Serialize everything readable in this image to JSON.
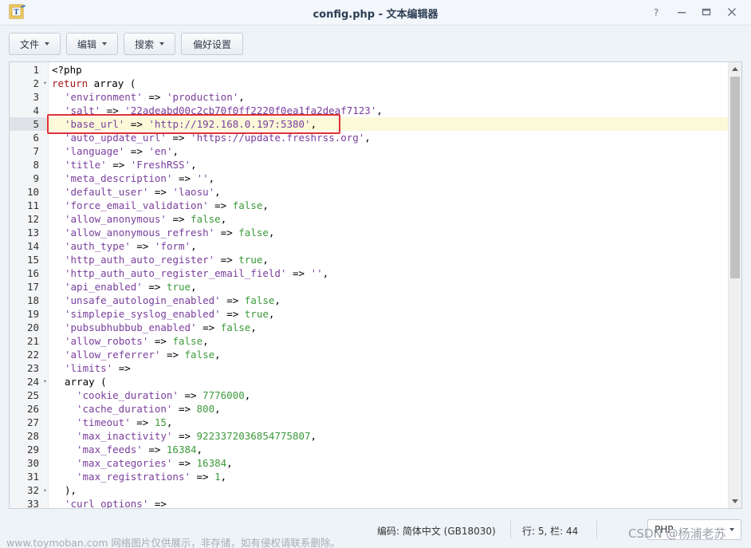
{
  "window": {
    "title": "config.php - 文本编辑器",
    "app_icon": "text-editor-icon",
    "controls": [
      "help-icon",
      "minimize-icon",
      "maximize-icon",
      "close-icon"
    ]
  },
  "toolbar": {
    "file_label": "文件",
    "edit_label": "编辑",
    "search_label": "搜索",
    "prefs_label": "偏好设置"
  },
  "editor": {
    "active_line": 5,
    "lines": [
      {
        "n": "1",
        "fold": "",
        "tokens": [
          {
            "t": "<?php",
            "c": "plain"
          }
        ]
      },
      {
        "n": "2",
        "fold": "▾",
        "tokens": [
          {
            "t": "return",
            "c": "kw"
          },
          {
            "t": " array (",
            "c": "plain"
          }
        ]
      },
      {
        "n": "3",
        "fold": "",
        "indent": 1,
        "tokens": [
          {
            "t": "'environment'",
            "c": "str"
          },
          {
            "t": " => ",
            "c": "op"
          },
          {
            "t": "'production'",
            "c": "str"
          },
          {
            "t": ",",
            "c": "op"
          }
        ]
      },
      {
        "n": "4",
        "fold": "",
        "indent": 1,
        "tokens": [
          {
            "t": "'salt'",
            "c": "str"
          },
          {
            "t": " => ",
            "c": "op"
          },
          {
            "t": "'22adeabd00c2cb70f0ff2220f0ea1fa2deaf7123'",
            "c": "str"
          },
          {
            "t": ",",
            "c": "op"
          }
        ]
      },
      {
        "n": "5",
        "fold": "",
        "indent": 1,
        "tokens": [
          {
            "t": "'base_url'",
            "c": "str"
          },
          {
            "t": " => ",
            "c": "op"
          },
          {
            "t": "'http://192.168.0.197:5380'",
            "c": "str"
          },
          {
            "t": ",",
            "c": "op"
          }
        ]
      },
      {
        "n": "6",
        "fold": "",
        "indent": 1,
        "tokens": [
          {
            "t": "'auto_update_url'",
            "c": "str"
          },
          {
            "t": " => ",
            "c": "op"
          },
          {
            "t": "'https://update.freshrss.org'",
            "c": "str"
          },
          {
            "t": ",",
            "c": "op"
          }
        ]
      },
      {
        "n": "7",
        "fold": "",
        "indent": 1,
        "tokens": [
          {
            "t": "'language'",
            "c": "str"
          },
          {
            "t": " => ",
            "c": "op"
          },
          {
            "t": "'en'",
            "c": "str"
          },
          {
            "t": ",",
            "c": "op"
          }
        ]
      },
      {
        "n": "8",
        "fold": "",
        "indent": 1,
        "tokens": [
          {
            "t": "'title'",
            "c": "str"
          },
          {
            "t": " => ",
            "c": "op"
          },
          {
            "t": "'FreshRSS'",
            "c": "str"
          },
          {
            "t": ",",
            "c": "op"
          }
        ]
      },
      {
        "n": "9",
        "fold": "",
        "indent": 1,
        "tokens": [
          {
            "t": "'meta_description'",
            "c": "str"
          },
          {
            "t": " => ",
            "c": "op"
          },
          {
            "t": "''",
            "c": "str"
          },
          {
            "t": ",",
            "c": "op"
          }
        ]
      },
      {
        "n": "10",
        "fold": "",
        "indent": 1,
        "tokens": [
          {
            "t": "'default_user'",
            "c": "str"
          },
          {
            "t": " => ",
            "c": "op"
          },
          {
            "t": "'laosu'",
            "c": "str"
          },
          {
            "t": ",",
            "c": "op"
          }
        ]
      },
      {
        "n": "11",
        "fold": "",
        "indent": 1,
        "tokens": [
          {
            "t": "'force_email_validation'",
            "c": "str"
          },
          {
            "t": " => ",
            "c": "op"
          },
          {
            "t": "false",
            "c": "bool"
          },
          {
            "t": ",",
            "c": "op"
          }
        ]
      },
      {
        "n": "12",
        "fold": "",
        "indent": 1,
        "tokens": [
          {
            "t": "'allow_anonymous'",
            "c": "str"
          },
          {
            "t": " => ",
            "c": "op"
          },
          {
            "t": "false",
            "c": "bool"
          },
          {
            "t": ",",
            "c": "op"
          }
        ]
      },
      {
        "n": "13",
        "fold": "",
        "indent": 1,
        "tokens": [
          {
            "t": "'allow_anonymous_refresh'",
            "c": "str"
          },
          {
            "t": " => ",
            "c": "op"
          },
          {
            "t": "false",
            "c": "bool"
          },
          {
            "t": ",",
            "c": "op"
          }
        ]
      },
      {
        "n": "14",
        "fold": "",
        "indent": 1,
        "tokens": [
          {
            "t": "'auth_type'",
            "c": "str"
          },
          {
            "t": " => ",
            "c": "op"
          },
          {
            "t": "'form'",
            "c": "str"
          },
          {
            "t": ",",
            "c": "op"
          }
        ]
      },
      {
        "n": "15",
        "fold": "",
        "indent": 1,
        "tokens": [
          {
            "t": "'http_auth_auto_register'",
            "c": "str"
          },
          {
            "t": " => ",
            "c": "op"
          },
          {
            "t": "true",
            "c": "bool"
          },
          {
            "t": ",",
            "c": "op"
          }
        ]
      },
      {
        "n": "16",
        "fold": "",
        "indent": 1,
        "tokens": [
          {
            "t": "'http_auth_auto_register_email_field'",
            "c": "str"
          },
          {
            "t": " => ",
            "c": "op"
          },
          {
            "t": "''",
            "c": "str"
          },
          {
            "t": ",",
            "c": "op"
          }
        ]
      },
      {
        "n": "17",
        "fold": "",
        "indent": 1,
        "tokens": [
          {
            "t": "'api_enabled'",
            "c": "str"
          },
          {
            "t": " => ",
            "c": "op"
          },
          {
            "t": "true",
            "c": "bool"
          },
          {
            "t": ",",
            "c": "op"
          }
        ]
      },
      {
        "n": "18",
        "fold": "",
        "indent": 1,
        "tokens": [
          {
            "t": "'unsafe_autologin_enabled'",
            "c": "str"
          },
          {
            "t": " => ",
            "c": "op"
          },
          {
            "t": "false",
            "c": "bool"
          },
          {
            "t": ",",
            "c": "op"
          }
        ]
      },
      {
        "n": "19",
        "fold": "",
        "indent": 1,
        "tokens": [
          {
            "t": "'simplepie_syslog_enabled'",
            "c": "str"
          },
          {
            "t": " => ",
            "c": "op"
          },
          {
            "t": "true",
            "c": "bool"
          },
          {
            "t": ",",
            "c": "op"
          }
        ]
      },
      {
        "n": "20",
        "fold": "",
        "indent": 1,
        "tokens": [
          {
            "t": "'pubsubhubbub_enabled'",
            "c": "str"
          },
          {
            "t": " => ",
            "c": "op"
          },
          {
            "t": "false",
            "c": "bool"
          },
          {
            "t": ",",
            "c": "op"
          }
        ]
      },
      {
        "n": "21",
        "fold": "",
        "indent": 1,
        "tokens": [
          {
            "t": "'allow_robots'",
            "c": "str"
          },
          {
            "t": " => ",
            "c": "op"
          },
          {
            "t": "false",
            "c": "bool"
          },
          {
            "t": ",",
            "c": "op"
          }
        ]
      },
      {
        "n": "22",
        "fold": "",
        "indent": 1,
        "tokens": [
          {
            "t": "'allow_referrer'",
            "c": "str"
          },
          {
            "t": " => ",
            "c": "op"
          },
          {
            "t": "false",
            "c": "bool"
          },
          {
            "t": ",",
            "c": "op"
          }
        ]
      },
      {
        "n": "23",
        "fold": "",
        "indent": 1,
        "tokens": [
          {
            "t": "'limits'",
            "c": "str"
          },
          {
            "t": " =>",
            "c": "op"
          }
        ]
      },
      {
        "n": "24",
        "fold": "▾",
        "indent": 1,
        "tokens": [
          {
            "t": "array (",
            "c": "plain"
          }
        ]
      },
      {
        "n": "25",
        "fold": "",
        "indent": 2,
        "tokens": [
          {
            "t": "'cookie_duration'",
            "c": "str"
          },
          {
            "t": " => ",
            "c": "op"
          },
          {
            "t": "7776000",
            "c": "num"
          },
          {
            "t": ",",
            "c": "op"
          }
        ]
      },
      {
        "n": "26",
        "fold": "",
        "indent": 2,
        "tokens": [
          {
            "t": "'cache_duration'",
            "c": "str"
          },
          {
            "t": " => ",
            "c": "op"
          },
          {
            "t": "800",
            "c": "num"
          },
          {
            "t": ",",
            "c": "op"
          }
        ]
      },
      {
        "n": "27",
        "fold": "",
        "indent": 2,
        "tokens": [
          {
            "t": "'timeout'",
            "c": "str"
          },
          {
            "t": " => ",
            "c": "op"
          },
          {
            "t": "15",
            "c": "num"
          },
          {
            "t": ",",
            "c": "op"
          }
        ]
      },
      {
        "n": "28",
        "fold": "",
        "indent": 2,
        "tokens": [
          {
            "t": "'max_inactivity'",
            "c": "str"
          },
          {
            "t": " => ",
            "c": "op"
          },
          {
            "t": "9223372036854775807",
            "c": "num"
          },
          {
            "t": ",",
            "c": "op"
          }
        ]
      },
      {
        "n": "29",
        "fold": "",
        "indent": 2,
        "tokens": [
          {
            "t": "'max_feeds'",
            "c": "str"
          },
          {
            "t": " => ",
            "c": "op"
          },
          {
            "t": "16384",
            "c": "num"
          },
          {
            "t": ",",
            "c": "op"
          }
        ]
      },
      {
        "n": "30",
        "fold": "",
        "indent": 2,
        "tokens": [
          {
            "t": "'max_categories'",
            "c": "str"
          },
          {
            "t": " => ",
            "c": "op"
          },
          {
            "t": "16384",
            "c": "num"
          },
          {
            "t": ",",
            "c": "op"
          }
        ]
      },
      {
        "n": "31",
        "fold": "",
        "indent": 2,
        "tokens": [
          {
            "t": "'max_registrations'",
            "c": "str"
          },
          {
            "t": " => ",
            "c": "op"
          },
          {
            "t": "1",
            "c": "num"
          },
          {
            "t": ",",
            "c": "op"
          }
        ]
      },
      {
        "n": "32",
        "fold": "▴",
        "indent": 1,
        "tokens": [
          {
            "t": "),",
            "c": "plain"
          }
        ]
      },
      {
        "n": "33",
        "fold": "",
        "indent": 1,
        "tokens": [
          {
            "t": "'curl_options'",
            "c": "str"
          },
          {
            "t": " =>",
            "c": "op"
          }
        ]
      }
    ]
  },
  "status": {
    "encoding": "编码: 简体中文 (GB18030)",
    "position": "行: 5, 栏: 44",
    "language_value": "PHP"
  },
  "watermarks": {
    "left": "www.toymoban.com 网络图片仅供展示，非存储，如有侵权请联系删除。",
    "right": "CSDN @杨浦老苏"
  },
  "colors": {
    "highlight_box": "#e03131",
    "active_line_bg": "#fbf9d8",
    "string": "#7a3e9d",
    "keyword": "#a31515",
    "number": "#3c9a3c"
  }
}
